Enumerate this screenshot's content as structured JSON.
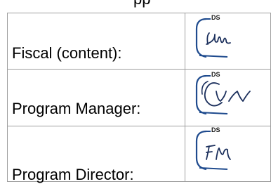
{
  "header": {
    "fragment_text": "pp"
  },
  "signatures": [
    {
      "label": "Fiscal (content):",
      "badge": "DS",
      "signature_image": "initials-LM-handwritten"
    },
    {
      "label": "Program Manager:",
      "badge": "DS",
      "signature_image": "initials-CV-handwritten"
    },
    {
      "label": "Program Director:",
      "badge": "DS",
      "signature_image": "initials-FM-handwritten"
    }
  ],
  "colors": {
    "docusign_bracket": "#1f4b8e",
    "ink": "#1b2f5c",
    "table_border": "#9e9e9e"
  }
}
